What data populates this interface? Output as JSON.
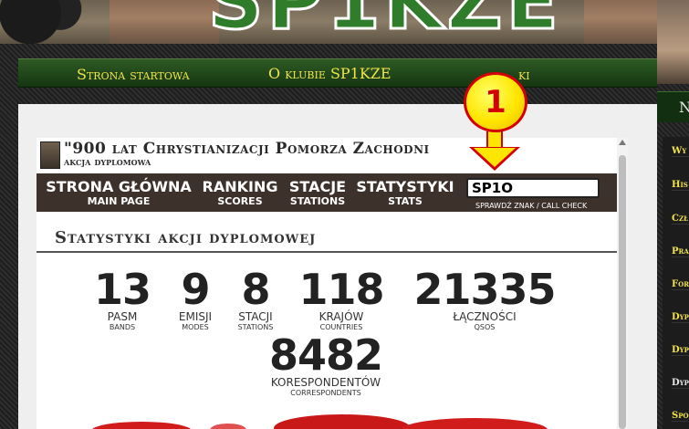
{
  "nav": {
    "items": [
      "Strona startowa",
      "O klubie SP1KZE",
      "Linki"
    ],
    "partial_hidden": "ki"
  },
  "sidebar": {
    "heading": "N",
    "items": [
      "Wy",
      "His",
      "Czł",
      "Pra",
      "For",
      "Dyp",
      "Dyp",
      "Dyp",
      "Spo"
    ]
  },
  "award": {
    "title": "\"900 lat Chrystianizacji Pomorza Zachodni",
    "subtitle": "akcja dyplomowa"
  },
  "inner_nav": [
    {
      "label": "STRONA GŁÓWNA",
      "sub": "MAIN PAGE"
    },
    {
      "label": "RANKING",
      "sub": "SCORES"
    },
    {
      "label": "STACJE",
      "sub": "STATIONS"
    },
    {
      "label": "STATYSTYKI",
      "sub": "STATS"
    }
  ],
  "call_check": {
    "value": "SP1O",
    "caption": "SPRAWDŹ ZNAK / CALL CHECK"
  },
  "stats": {
    "heading": "Statystyki akcji dyplomowej",
    "items": [
      {
        "value": "13",
        "label": "PASM",
        "sub": "BANDS"
      },
      {
        "value": "9",
        "label": "EMISJI",
        "sub": "MODES"
      },
      {
        "value": "8",
        "label": "STACJI",
        "sub": "STATIONS"
      },
      {
        "value": "118",
        "label": "KRAJÓW",
        "sub": "COUNTRIES"
      },
      {
        "value": "21335",
        "label": "ŁĄCZNOŚCI",
        "sub": "QSOS"
      },
      {
        "value": "8482",
        "label": "KORESPONDENTÓW",
        "sub": "CORRESPONDENTS"
      }
    ]
  },
  "annotation": {
    "number": "1"
  },
  "colors": {
    "accent_yellow": "#f1e34a",
    "nav_green": "#1f4419",
    "inner_nav_brown": "#3d312b",
    "badge_red": "#d40000"
  }
}
